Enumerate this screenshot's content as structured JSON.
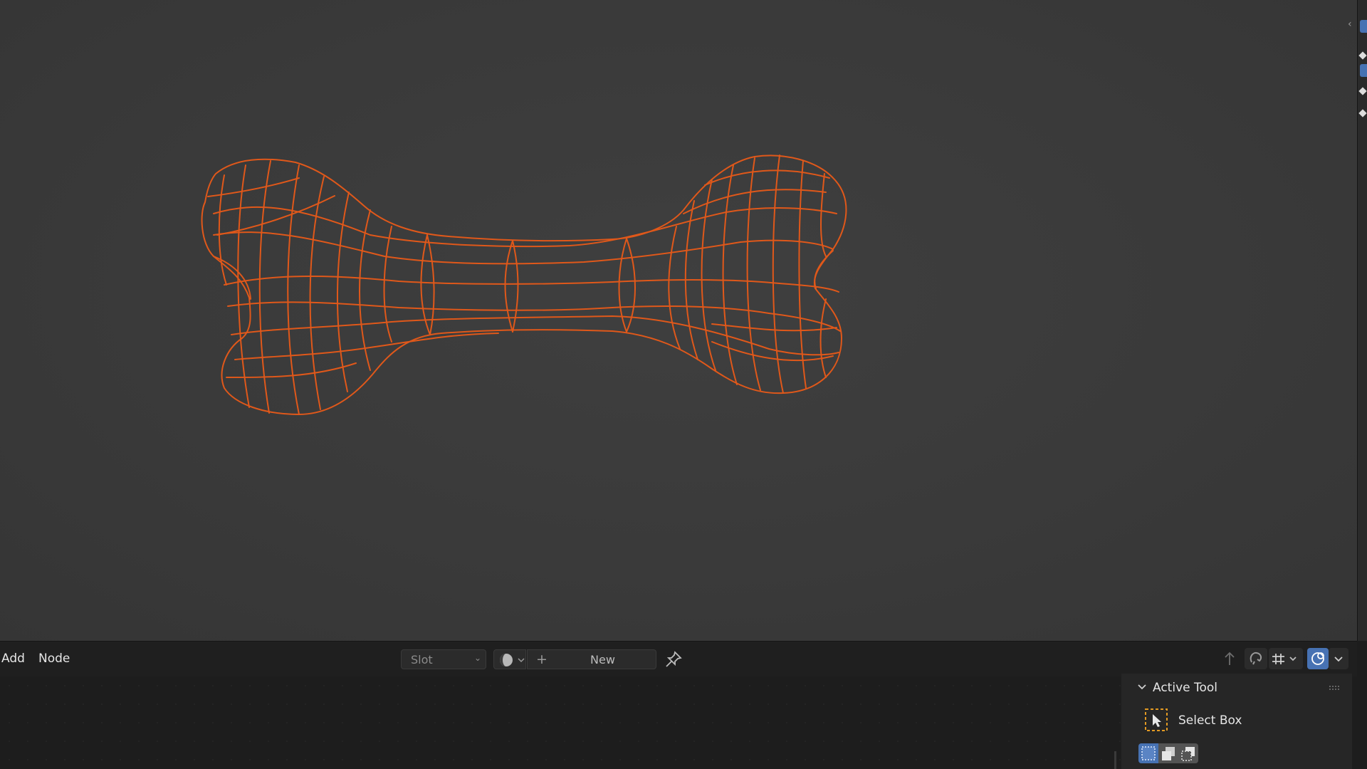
{
  "header": {
    "menus": [
      {
        "label": "Add"
      },
      {
        "label": "Node"
      }
    ],
    "slot_select": {
      "label": "Slot",
      "chevron_icon": "chevron-down-icon"
    },
    "material_browse": {
      "icon": "material-sphere-icon"
    },
    "new_material": {
      "icon": "plus-icon",
      "label": "New"
    },
    "pin": {
      "icon": "pin-icon"
    },
    "right_controls": [
      {
        "name": "parent-node-tree-icon"
      },
      {
        "name": "snap-icon"
      },
      {
        "name": "grid-snap-icon"
      },
      {
        "name": "overlay-toggle-icon"
      }
    ]
  },
  "active_tool_panel": {
    "title": "Active Tool",
    "tool_name": "Select Box",
    "modes": [
      "select-set-icon",
      "select-extend-icon",
      "select-subtract-icon"
    ]
  },
  "colors": {
    "wire": "#e0581a",
    "viewport_bg": "#3a3a3a",
    "accent": "#4772b3",
    "tool_outline": "#e39a23"
  }
}
